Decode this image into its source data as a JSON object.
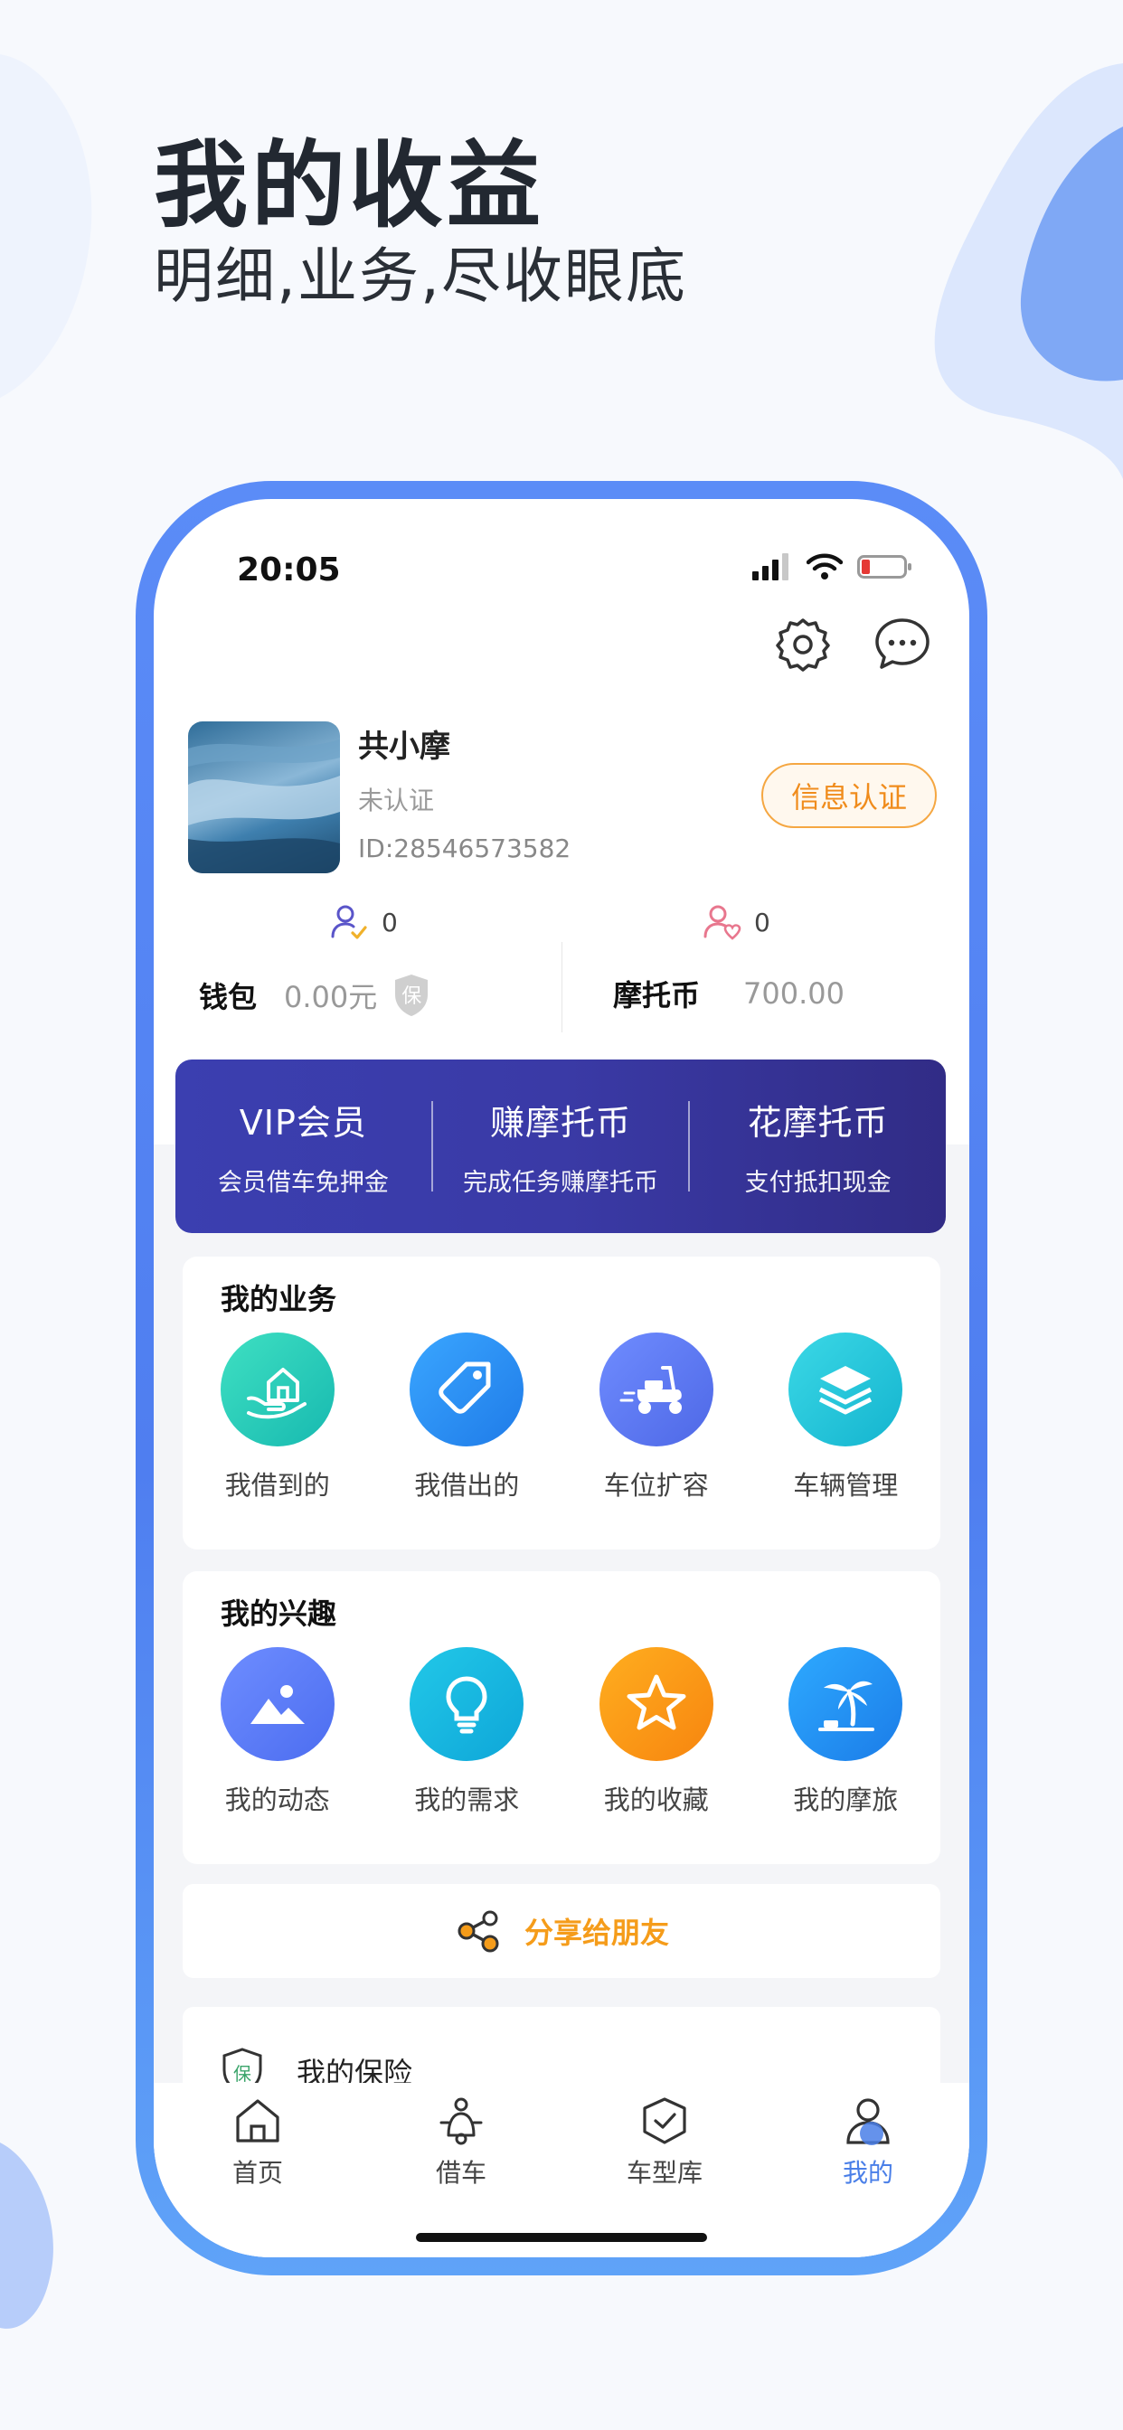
{
  "promo": {
    "title": "我的收益",
    "subtitle": "明细,业务,尽收眼底"
  },
  "status_bar": {
    "time": "20:05"
  },
  "colors": {
    "brand_blue": "#4f7ef0",
    "vip_purple": "#3b3fb0",
    "accent_orange": "#f08c1c",
    "active_tab": "#4a7fe8"
  },
  "header": {
    "icons": [
      "settings-icon",
      "message-icon"
    ]
  },
  "profile": {
    "name": "共小摩",
    "status": "未认证",
    "id_text": "ID:28546573582",
    "cert_button": "信息认证",
    "following_count": "0",
    "followers_count": "0"
  },
  "wallet": {
    "label": "钱包",
    "value": "0.00元",
    "badge": "保",
    "coin_label": "摩托币",
    "coin_value": "700.00"
  },
  "vip_banner": [
    {
      "title": "VIP会员",
      "sub": "会员借车免押金"
    },
    {
      "title": "赚摩托币",
      "sub": "完成任务赚摩托币"
    },
    {
      "title": "花摩托币",
      "sub": "支付抵扣现金"
    }
  ],
  "business": {
    "title": "我的业务",
    "items": [
      {
        "label": "我借到的",
        "icon": "hand-house-icon"
      },
      {
        "label": "我借出的",
        "icon": "tag-icon"
      },
      {
        "label": "车位扩容",
        "icon": "scooter-icon"
      },
      {
        "label": "车辆管理",
        "icon": "layers-icon"
      }
    ]
  },
  "interests": {
    "title": "我的兴趣",
    "items": [
      {
        "label": "我的动态",
        "icon": "image-icon"
      },
      {
        "label": "我的需求",
        "icon": "lightbulb-icon"
      },
      {
        "label": "我的收藏",
        "icon": "star-icon"
      },
      {
        "label": "我的摩旅",
        "icon": "palm-tree-icon"
      }
    ]
  },
  "share": {
    "label": "分享给朋友"
  },
  "insurance": {
    "label": "我的保险",
    "badge": "保"
  },
  "tabbar": [
    {
      "label": "首页",
      "icon": "home-icon",
      "active": false
    },
    {
      "label": "借车",
      "icon": "scooter-rider-icon",
      "active": false
    },
    {
      "label": "车型库",
      "icon": "box-check-icon",
      "active": false
    },
    {
      "label": "我的",
      "icon": "profile-icon",
      "active": true
    }
  ]
}
